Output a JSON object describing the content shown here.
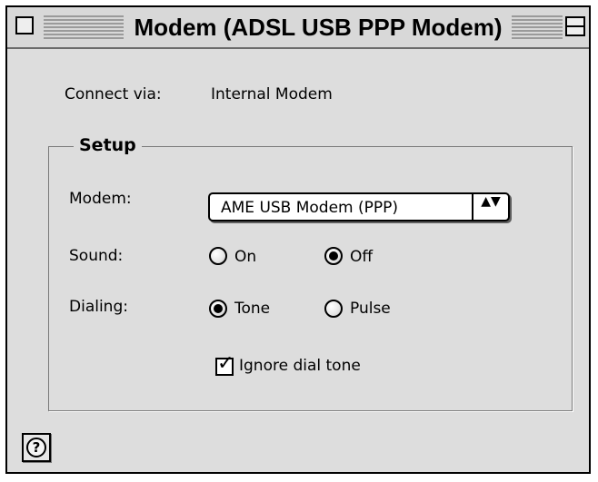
{
  "window": {
    "title": "Modem (ADSL USB PPP Modem)"
  },
  "connect": {
    "label": "Connect via:",
    "value": "Internal Modem"
  },
  "setup": {
    "group_title": "Setup",
    "modem_label": "Modem:",
    "modem_selected": "AME USB Modem (PPP)",
    "modem_popup_arrows": "▲▼",
    "sound_label": "Sound:",
    "sound_options": [
      "On",
      "Off"
    ],
    "sound_selected": "Off",
    "dialing_label": "Dialing:",
    "dialing_options": [
      "Tone",
      "Pulse"
    ],
    "dialing_selected": "Tone",
    "ignore_dial_tone_label": "Ignore dial tone",
    "ignore_dial_tone_checked": true
  },
  "help": {
    "icon": "help-icon",
    "glyph": "?"
  },
  "colors": {
    "window_bg": "#dddddd",
    "title_stripes": "#9a9a9a",
    "group_border": "#7a7a7a"
  }
}
